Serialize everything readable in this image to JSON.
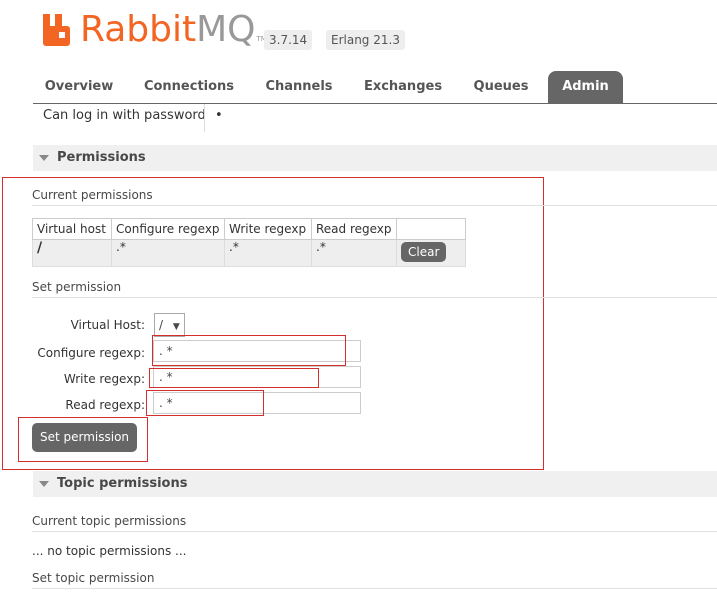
{
  "header": {
    "logo_rabbit": "Rabbit",
    "logo_mq": "MQ",
    "logo_tm": "TM",
    "version": "3.7.14",
    "erlang": "Erlang 21.3"
  },
  "tabs": [
    {
      "label": "Overview"
    },
    {
      "label": "Connections"
    },
    {
      "label": "Channels"
    },
    {
      "label": "Exchanges"
    },
    {
      "label": "Queues"
    },
    {
      "label": "Admin",
      "active": true
    }
  ],
  "user_row": {
    "label": "Can log in with password",
    "value": "•"
  },
  "permissions": {
    "title": "Permissions",
    "current_heading": "Current permissions",
    "table": {
      "headers": [
        "Virtual host",
        "Configure regexp",
        "Write regexp",
        "Read regexp"
      ],
      "rows": [
        {
          "vhost": "/",
          "configure": ".*",
          "write": ".*",
          "read": ".*",
          "action": "Clear"
        }
      ]
    },
    "set_heading": "Set permission",
    "form": {
      "vhost_label": "Virtual Host:",
      "vhost_value": "/",
      "configure_label": "Configure regexp:",
      "configure_value": ". *",
      "write_label": "Write regexp:",
      "write_value": ". *",
      "read_label": "Read regexp:",
      "read_value": ". *",
      "submit_label": "Set permission"
    }
  },
  "topic_permissions": {
    "title": "Topic permissions",
    "current_heading": "Current topic permissions",
    "empty_text": "... no topic permissions ...",
    "set_heading": "Set topic permission"
  },
  "colors": {
    "brand_orange": "#f26522",
    "tab_active": "#666666",
    "highlight_red": "#d32f2f"
  }
}
